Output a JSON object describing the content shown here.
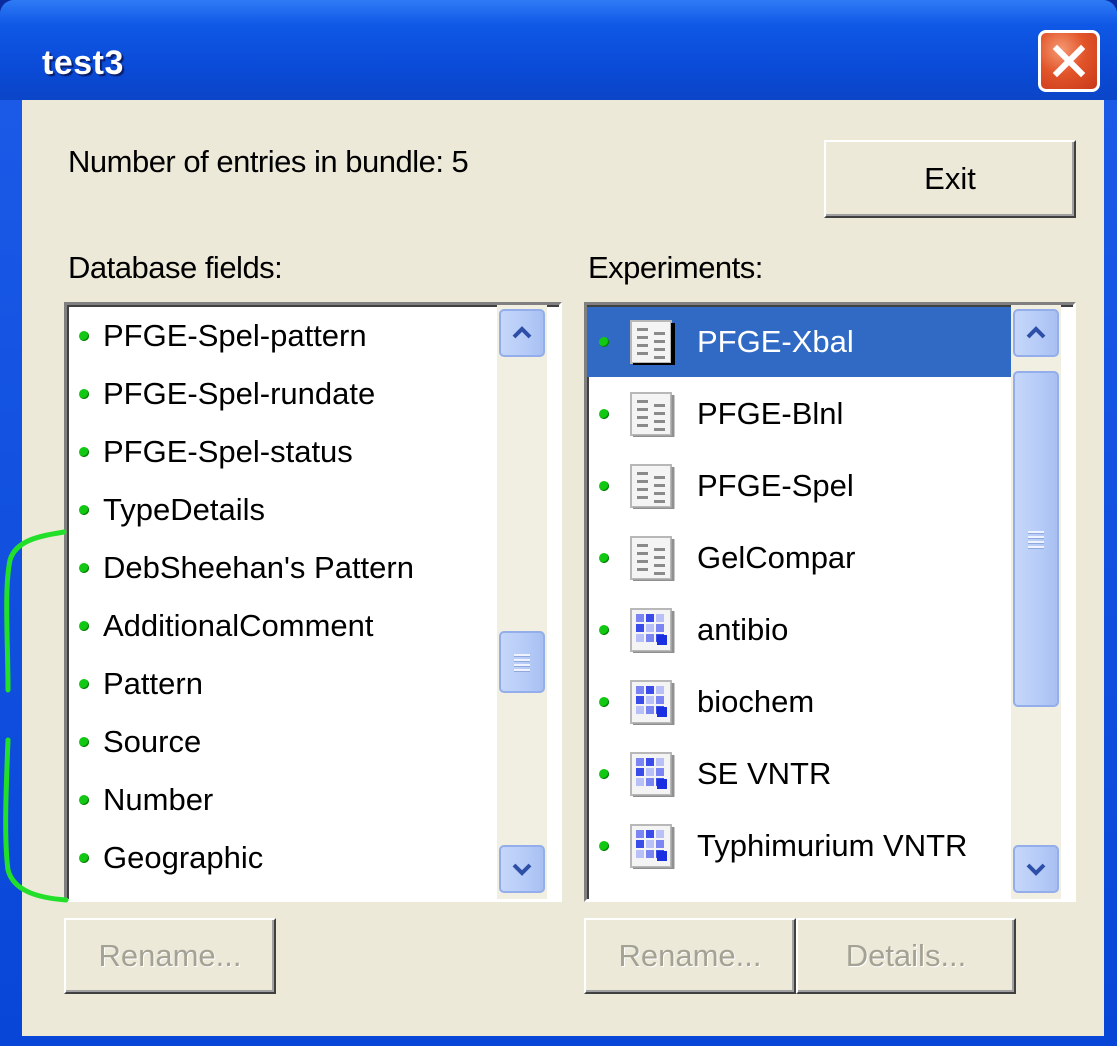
{
  "window": {
    "title": "test3",
    "close_icon": "close-icon"
  },
  "bundle": {
    "entries_label": "Number of entries in bundle: 5"
  },
  "buttons": {
    "exit": "Exit",
    "rename_fields": "Rename...",
    "rename_experiments": "Rename...",
    "details": "Details..."
  },
  "database_fields": {
    "label": "Database fields:",
    "items": [
      "PFGE-Spel-pattern",
      "PFGE-Spel-rundate",
      "PFGE-Spel-status",
      "TypeDetails",
      "DebSheehan's Pattern",
      "AdditionalComment",
      "Pattern",
      "Source",
      "Number",
      "Geographic"
    ]
  },
  "experiments": {
    "label": "Experiments:",
    "selected": "PFGE-Xbal",
    "items": [
      {
        "name": "PFGE-Xbal",
        "icon": "fingerprint-icon"
      },
      {
        "name": "PFGE-Blnl",
        "icon": "fingerprint-icon"
      },
      {
        "name": "PFGE-Spel",
        "icon": "fingerprint-icon"
      },
      {
        "name": "GelCompar",
        "icon": "fingerprint-icon"
      },
      {
        "name": "antibio",
        "icon": "character-grid-icon"
      },
      {
        "name": "biochem",
        "icon": "character-grid-icon"
      },
      {
        "name": "SE VNTR",
        "icon": "character-grid-icon"
      },
      {
        "name": "Typhimurium VNTR",
        "icon": "character-grid-icon"
      }
    ]
  },
  "colors": {
    "selection": "#316ac5",
    "bullet": "#12c812",
    "annotation": "#22e02a"
  }
}
